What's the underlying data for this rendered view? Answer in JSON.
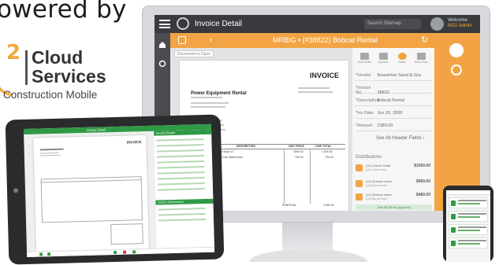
{
  "brand": {
    "powered_by": "owered by",
    "logo_number": "2",
    "logo_word1": "Cloud",
    "logo_word2": "Services",
    "logo_subtitle": "Construction Mobile",
    "accent_color": "#f0a93a"
  },
  "desktop_app": {
    "window_title": "Invoice Detail",
    "search_placeholder": "Search Sitemap",
    "welcome_label": "Welcome",
    "user_name": "MS2 Admin",
    "nav_title": "MRBIG • (#38822) Bobcat Rental",
    "document_button": "Document to Open",
    "toolbar": [
      {
        "label": "Save Draft",
        "icon": "save-icon"
      },
      {
        "label": "Approve",
        "icon": "approve-icon"
      },
      {
        "label": "Notes",
        "icon": "notes-icon"
      },
      {
        "label": "Work Flow",
        "icon": "workflow-icon"
      }
    ],
    "invoice": {
      "heading": "INVOICE",
      "company": "Power Equipment Rental",
      "col_description": "DESCRIPTION",
      "col_unit_price": "UNIT PRICE",
      "col_line_total": "LINE TOTAL",
      "row1_desc": "Bobcat Rental delive Out Days 47",
      "row1_price": "1590.00",
      "row1_total": "1,590.00",
      "row2_desc": "Compressor Rental 1W Fuse Warehouse",
      "row2_price": "790.00",
      "row2_total": "790.00",
      "subtotal_label": "SUBTOTAL",
      "subtotal_value": "2,380.00"
    },
    "fields": [
      {
        "label": "*Vendor",
        "value": "Beaverton Sand & Gra"
      },
      {
        "label": "*Invoice No.",
        "value": "38822"
      },
      {
        "label": "*Description",
        "value": "Bobcat Rental"
      },
      {
        "label": "*Inv Date",
        "value": "Jun 26, 2008"
      },
      {
        "label": "*Amount",
        "value": "2380.00"
      }
    ],
    "see_all_link": "See All Header Fields",
    "distributions_label": "Distributions",
    "distributions": [
      {
        "name": "(U1) Crane rental",
        "amount": "$1000.00",
        "sub": "(U1) Crane rental"
      },
      {
        "name": "(U1) Bobcat rental",
        "amount": "$900.00",
        "sub": "(U1) Bobcat rental"
      },
      {
        "name": "(U1) Bobcat rental",
        "amount": "$480.00",
        "sub": "(U1) Bobcat rental"
      }
    ],
    "approved_text": "Total: $2,380.00 (approved)"
  },
  "tablet_app": {
    "top_label": "Invoice Detail",
    "invoice_heading": "INVOICE",
    "panel_header": "Invoice Header",
    "panel_dist": "Invoice Distributions"
  },
  "phone_app": {
    "cards": [
      {
        "name": "(U1) Electrical Wholesale"
      },
      {
        "name": "National Electrical Wholesale"
      },
      {
        "name": "(U1) Electrical Wholesale"
      },
      {
        "name": "Synth Electric"
      }
    ]
  }
}
